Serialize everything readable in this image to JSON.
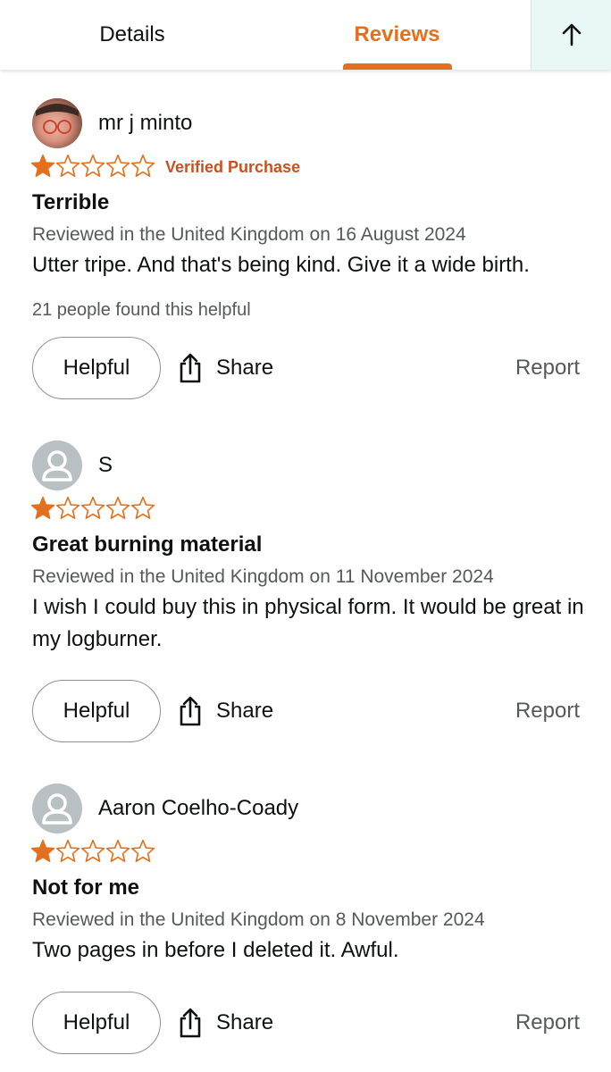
{
  "tabs": {
    "details_label": "Details",
    "reviews_label": "Reviews",
    "active": "reviews"
  },
  "colors": {
    "accent": "#e3701f",
    "star": "#e3701f",
    "verified": "#c7511f",
    "muted_text": "#565959"
  },
  "icons": {
    "scroll_top": "arrow-up-icon",
    "share": "share-icon",
    "star_filled": "star-filled-icon",
    "star_empty": "star-outline-icon",
    "generic_avatar": "user-icon"
  },
  "reviews": [
    {
      "reviewer": "mr j minto",
      "avatar": "photo",
      "rating": 1,
      "max_rating": 5,
      "verified": "Verified Purchase",
      "title": "Terrible",
      "meta": "Reviewed in the United Kingdom on 16 August 2024",
      "body": "Utter tripe. And that's being kind. Give it a wide birth.",
      "helpful_count": "21 people found this helpful",
      "helpful_label": "Helpful",
      "share_label": "Share",
      "report_label": "Report"
    },
    {
      "reviewer": "S",
      "avatar": "generic",
      "rating": 1,
      "max_rating": 5,
      "verified": "",
      "title": "Great burning material",
      "meta": "Reviewed in the United Kingdom on 11 November 2024",
      "body": "I wish I could buy this in physical form. It would be great in my logburner.",
      "helpful_count": "",
      "helpful_label": "Helpful",
      "share_label": "Share",
      "report_label": "Report"
    },
    {
      "reviewer": "Aaron Coelho-Coady",
      "avatar": "generic",
      "rating": 1,
      "max_rating": 5,
      "verified": "",
      "title": "Not for me",
      "meta": "Reviewed in the United Kingdom on 8 November 2024",
      "body": "Two pages in before I deleted it. Awful.",
      "helpful_count": "",
      "helpful_label": "Helpful",
      "share_label": "Share",
      "report_label": "Report"
    }
  ]
}
